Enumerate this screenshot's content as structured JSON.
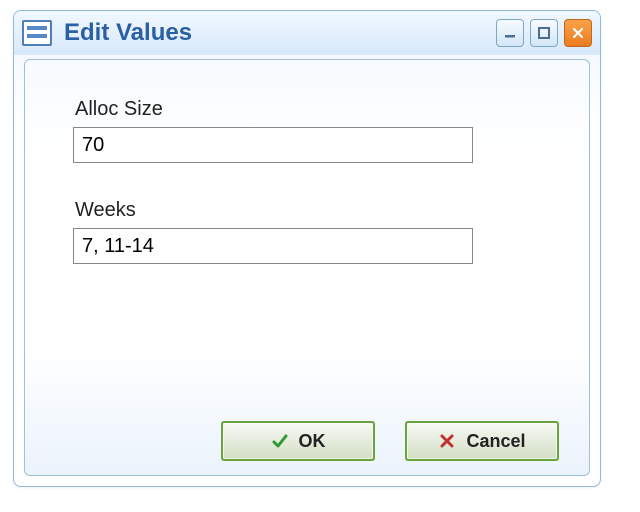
{
  "window": {
    "title": "Edit Values"
  },
  "fields": {
    "allocSize": {
      "label": "Alloc Size",
      "value": "70"
    },
    "weeks": {
      "label": "Weeks",
      "value": "7, 11-14"
    }
  },
  "buttons": {
    "ok": "OK",
    "cancel": "Cancel"
  }
}
